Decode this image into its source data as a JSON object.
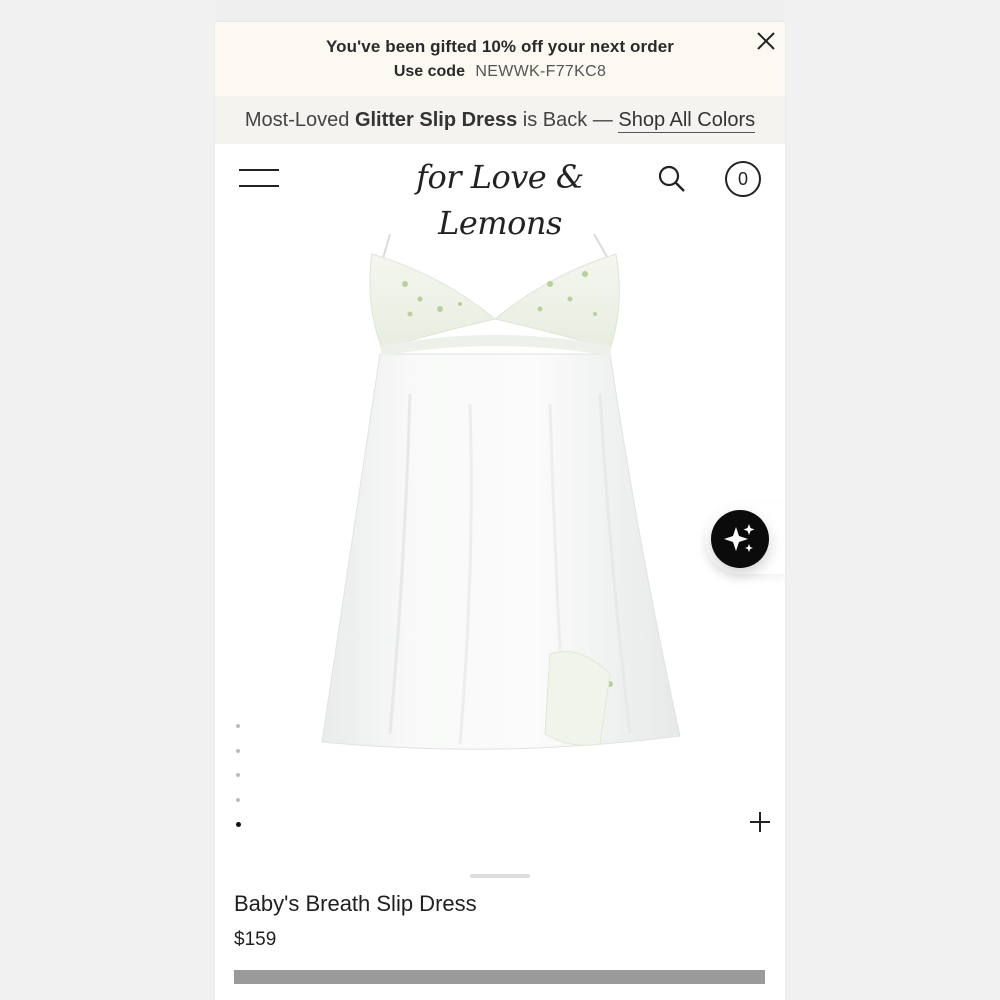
{
  "promo": {
    "title": "You've been gifted 10% off your next order",
    "code_label": "Use code",
    "code": "NEWWK-F77KC8"
  },
  "announcement": {
    "prefix": "Most-Loved ",
    "product": "Glitter Slip Dress",
    "suffix": " is Back — ",
    "link": "Shop All Colors"
  },
  "header": {
    "logo": "for Love & Lemons",
    "cart_count": "0"
  },
  "gallery": {
    "total_images": 5,
    "active_index": 4
  },
  "product": {
    "name": "Baby's Breath Slip Dress",
    "price": "$159"
  },
  "icons": {
    "close": "close-icon",
    "menu": "hamburger-menu-icon",
    "search": "search-icon",
    "cart": "cart-count-icon",
    "ai": "sparkles-icon",
    "plus": "plus-icon"
  },
  "colors": {
    "promo_bg": "#fbf9f2",
    "announce_bg": "#f4f3ef",
    "ai_button": "#0b0b0b",
    "add_bar": "#9a9a9a"
  }
}
